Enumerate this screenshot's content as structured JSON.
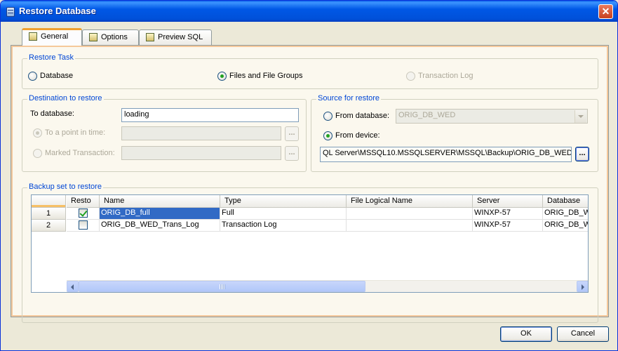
{
  "window": {
    "title": "Restore Database"
  },
  "tabs": [
    {
      "label": "General"
    },
    {
      "label": "Options"
    },
    {
      "label": "Preview SQL"
    }
  ],
  "restore_task": {
    "legend": "Restore Task",
    "options": [
      {
        "label": "Database",
        "checked": false,
        "enabled": true
      },
      {
        "label": "Files and File Groups",
        "checked": true,
        "enabled": true
      },
      {
        "label": "Transaction Log",
        "checked": false,
        "enabled": false
      }
    ]
  },
  "destination": {
    "legend": "Destination to restore",
    "to_database_label": "To database:",
    "to_database_value": "loading",
    "point_in_time_label": "To a point in time:",
    "marked_transaction_label": "Marked Transaction:",
    "point_in_time_value": "",
    "marked_transaction_value": "",
    "browse_label": "...",
    "browse2_label": "..."
  },
  "source": {
    "legend": "Source for restore",
    "from_database_label": "From database:",
    "from_database_value": "ORIG_DB_WED",
    "from_device_label": "From device:",
    "device_path": "QL Server\\MSSQL10.MSSQLSERVER\\MSSQL\\Backup\\ORIG_DB_WED.bak",
    "browse_label": "..."
  },
  "backup_set": {
    "legend": "Backup set to restore",
    "columns": [
      "Resto",
      "Name",
      "Type",
      "File Logical Name",
      "Server",
      "Database"
    ],
    "rows": [
      {
        "num": "1",
        "restore": true,
        "name": "ORIG_DB_full",
        "type": "Full",
        "file_logical_name": "",
        "server": "WINXP-57",
        "database": "ORIG_DB_WE"
      },
      {
        "num": "2",
        "restore": false,
        "name": "ORIG_DB_WED_Trans_Log",
        "type": "Transaction Log",
        "file_logical_name": "",
        "server": "WINXP-57",
        "database": "ORIG_DB_WE"
      }
    ]
  },
  "buttons": {
    "ok": "OK",
    "cancel": "Cancel"
  },
  "colors": {
    "titlebar": "#0058e6",
    "accent_tab": "#f0a030",
    "legend_text": "#0046d5",
    "selection": "#316ac5",
    "radio_dot": "#21a121"
  }
}
